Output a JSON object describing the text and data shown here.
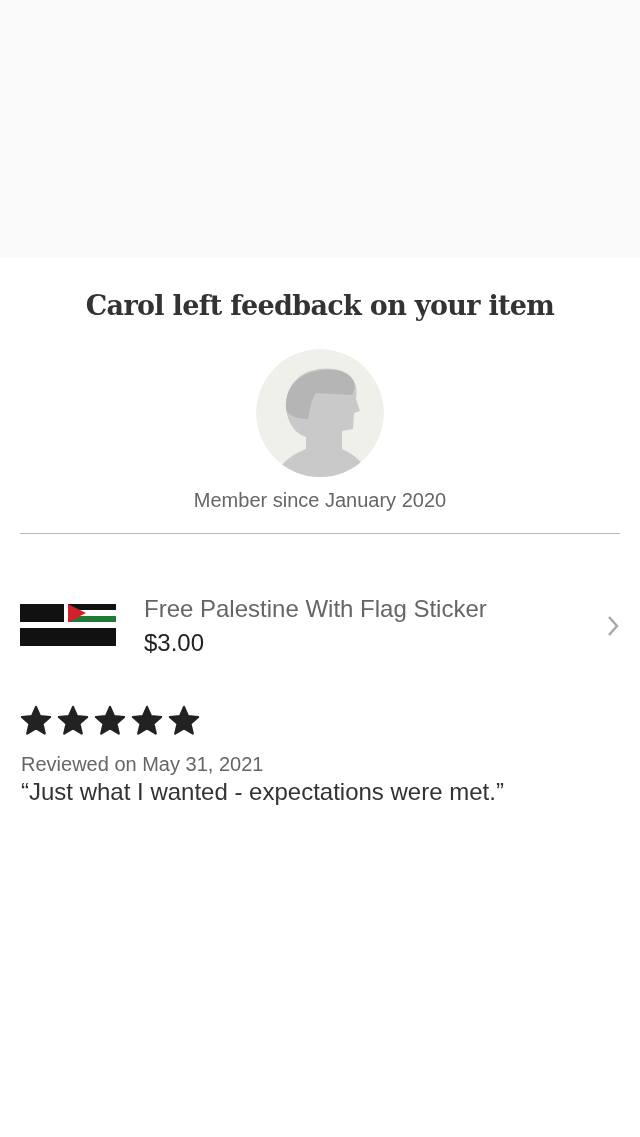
{
  "title": "Carol left feedback on your item",
  "member_since": "Member since January 2020",
  "item": {
    "name": "Free Palestine With Flag Sticker",
    "price": "$3.00"
  },
  "review": {
    "stars": 5,
    "date": "Reviewed on May 31, 2021",
    "text": "“Just what I wanted - expectations were met.”"
  }
}
